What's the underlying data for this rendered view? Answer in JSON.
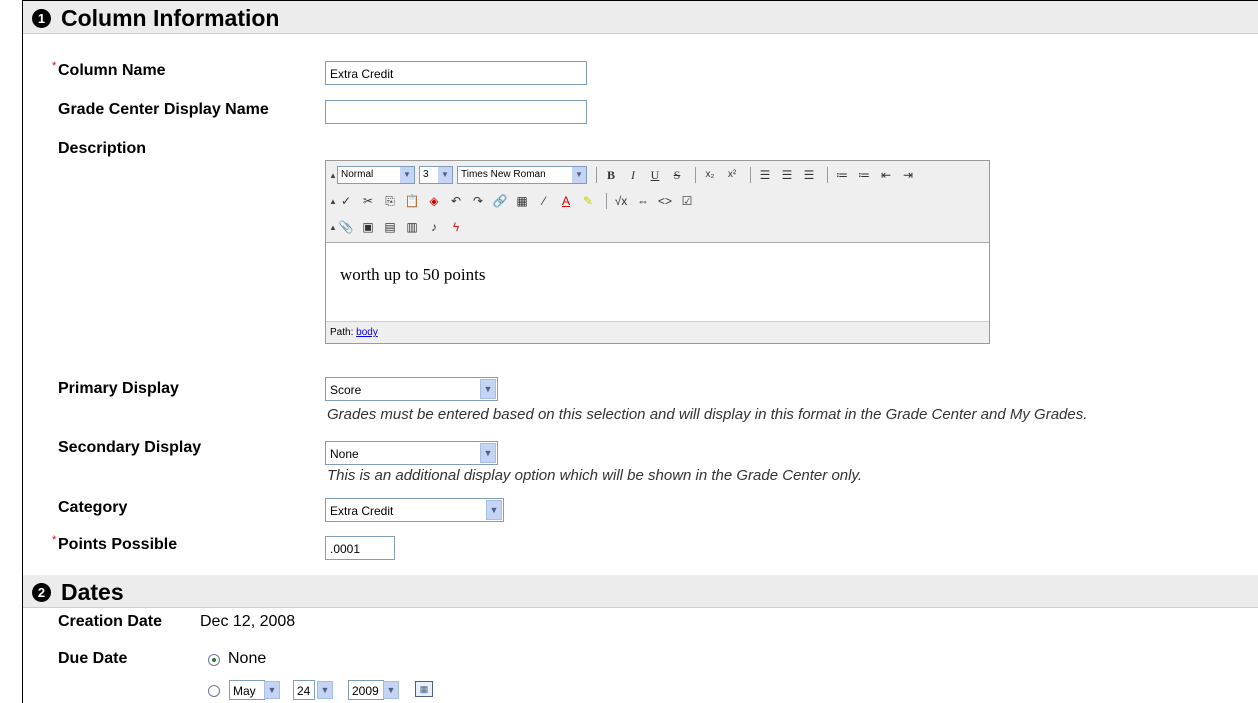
{
  "section1": {
    "number": "1",
    "title": "Column Information"
  },
  "section2": {
    "number": "2",
    "title": "Dates"
  },
  "required_mark": "*",
  "fields": {
    "column_name": {
      "label": "Column Name",
      "value": "Extra Credit"
    },
    "display_name": {
      "label": "Grade Center Display Name",
      "value": ""
    },
    "description": {
      "label": "Description"
    },
    "primary_display": {
      "label": "Primary Display",
      "value": "Score",
      "help": "Grades must be entered based on this selection and will display in this format in the Grade Center and My Grades."
    },
    "secondary_display": {
      "label": "Secondary Display",
      "value": "None",
      "help": "This is an additional display option which will be shown in the Grade Center only."
    },
    "category": {
      "label": "Category",
      "value": "Extra Credit"
    },
    "points_possible": {
      "label": "Points Possible",
      "value": ".0001"
    }
  },
  "editor": {
    "format": "Normal",
    "size": "3",
    "font": "Times New Roman",
    "content": "worth up to 50 points",
    "path_label": "Path:",
    "path_link": "body"
  },
  "dates": {
    "creation_label": "Creation Date",
    "creation_value": "Dec 12, 2008",
    "due_label": "Due Date",
    "none_label": "None",
    "month": "May",
    "day": "24",
    "year": "2009"
  }
}
